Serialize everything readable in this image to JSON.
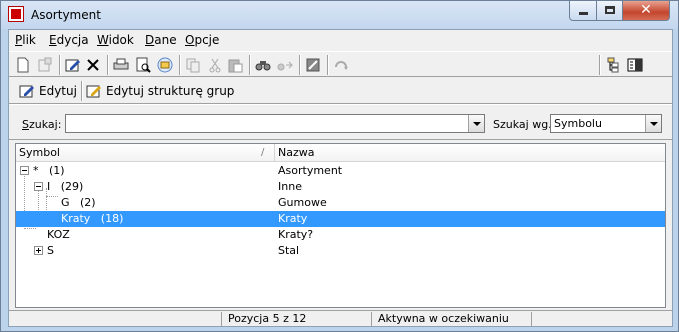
{
  "window": {
    "title": "Asortyment",
    "close_glyph": "✕"
  },
  "menu": [
    {
      "accel": "P",
      "rest": "lik"
    },
    {
      "accel": "E",
      "rest": "dycja"
    },
    {
      "accel": "W",
      "rest": "idok"
    },
    {
      "accel": "D",
      "rest": "ane"
    },
    {
      "accel": "O",
      "rest": "pcje"
    }
  ],
  "toolbar2": {
    "edit_label": "Edytuj",
    "edit_groups_label": "Edytuj strukturę grup"
  },
  "search": {
    "label_accel": "S",
    "label_rest": "zukaj:",
    "value": "",
    "by_label": "Szukaj wg.",
    "by_value": "Symbolu"
  },
  "grid": {
    "col_symbol": "Symbol",
    "col_name": "Nazwa",
    "sort_glyph": "/",
    "rows": [
      {
        "symbol": "*   (1)",
        "name": "Asortyment"
      },
      {
        "symbol": "I   (29)",
        "name": "Inne"
      },
      {
        "symbol": "G   (2)",
        "name": "Gumowe"
      },
      {
        "symbol": "Kraty   (18)",
        "name": "Kraty"
      },
      {
        "symbol": "KOZ",
        "name": "Kraty?"
      },
      {
        "symbol": "S",
        "name": "Stal"
      }
    ]
  },
  "status": {
    "position": "Pozycja 5 z 12",
    "state": "Aktywna w oczekiwaniu"
  },
  "colors": {
    "selection": "#3399ff",
    "chrome": "#f0f0f0",
    "title_gradient_top": "#d9e6f5"
  }
}
